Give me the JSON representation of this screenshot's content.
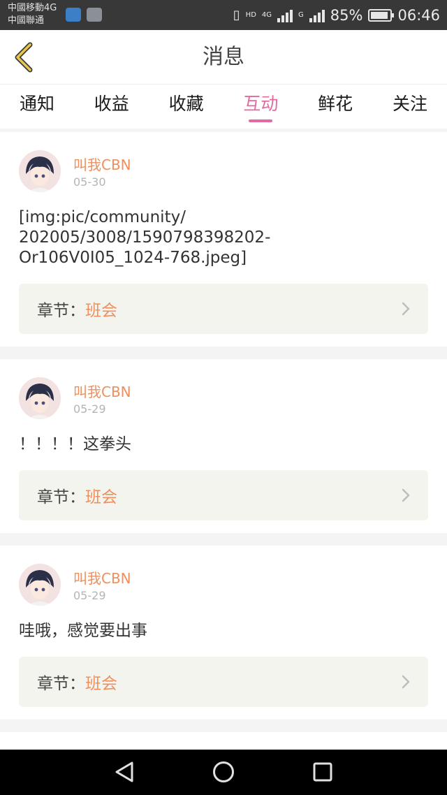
{
  "status_bar": {
    "carrier_line1": "中國移動4G",
    "carrier_line2": "中國聯通",
    "hd": "HD",
    "net1": "4G",
    "net2": "G",
    "battery": "85%",
    "time": "06:46"
  },
  "header": {
    "title": "消息"
  },
  "tabs": [
    {
      "label": "通知"
    },
    {
      "label": "收益"
    },
    {
      "label": "收藏"
    },
    {
      "label": "互动",
      "active": true
    },
    {
      "label": "鲜花"
    },
    {
      "label": "关注"
    }
  ],
  "messages": [
    {
      "user": "叫我CBN",
      "date": "05-30",
      "content": "[img:pic/community/\n202005/3008/1590798398202-\nOr106V0I05_1024-768.jpeg]",
      "chapter_label": "章节：",
      "chapter_name": "班会"
    },
    {
      "user": "叫我CBN",
      "date": "05-29",
      "content": "！！！！这拳头",
      "chapter_label": "章节：",
      "chapter_name": "班会"
    },
    {
      "user": "叫我CBN",
      "date": "05-29",
      "content": "哇哦，感觉要出事",
      "chapter_label": "章节：",
      "chapter_name": "班会"
    }
  ],
  "colors": {
    "accent": "#e26aa0",
    "name_orange": "#ee8f5c",
    "back_yellow": "#e7c84a"
  },
  "nav": {
    "back_icon": "triangle-back-icon",
    "home_icon": "circle-home-icon",
    "recent_icon": "square-recents-icon"
  }
}
